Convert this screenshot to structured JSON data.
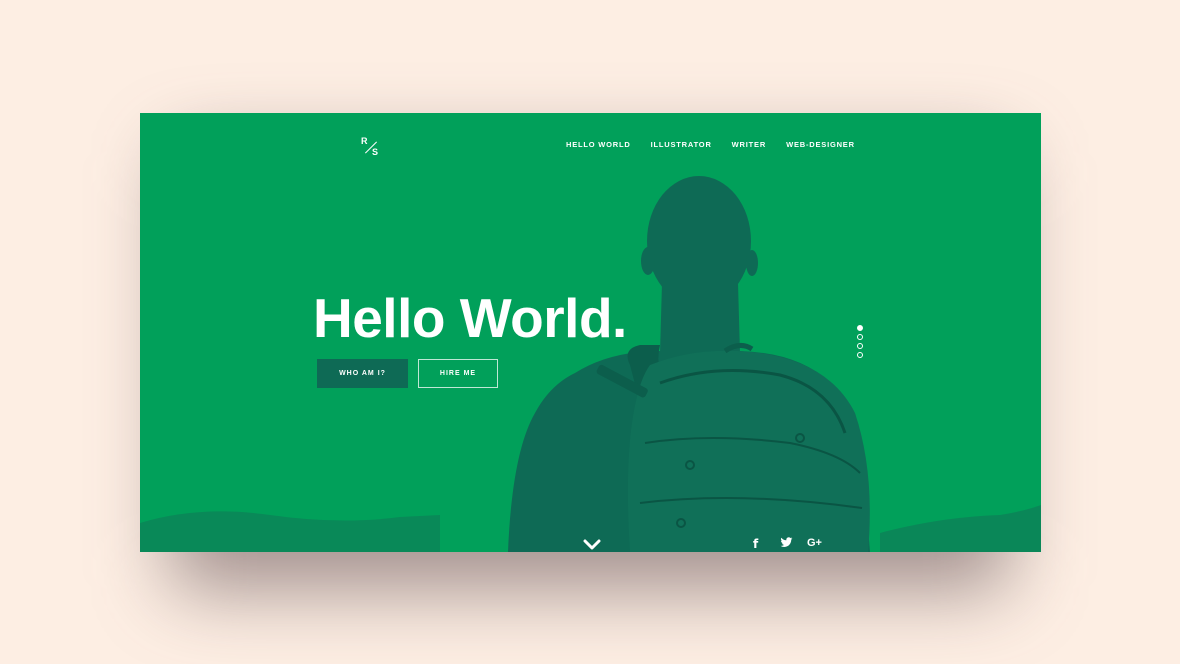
{
  "logo": {
    "top": "R",
    "bottom": "S"
  },
  "nav": {
    "items": [
      {
        "label": "HELLO WORLD"
      },
      {
        "label": "ILLUSTRATOR"
      },
      {
        "label": "WRITER"
      },
      {
        "label": "WEB-DESIGNER"
      }
    ]
  },
  "hero": {
    "title": "Hello World.",
    "primary_button": "WHO AM I?",
    "secondary_button": "HIRE ME"
  },
  "slider": {
    "count": 4,
    "active_index": 0
  },
  "social": {
    "facebook": "f",
    "googleplus": "G+"
  },
  "colors": {
    "page_bg": "#fdeee3",
    "accent_green": "#01a05a",
    "dark_teal": "#0e6a55"
  },
  "icons": [
    "scroll-down-icon",
    "facebook-icon",
    "twitter-icon",
    "google-plus-icon"
  ]
}
